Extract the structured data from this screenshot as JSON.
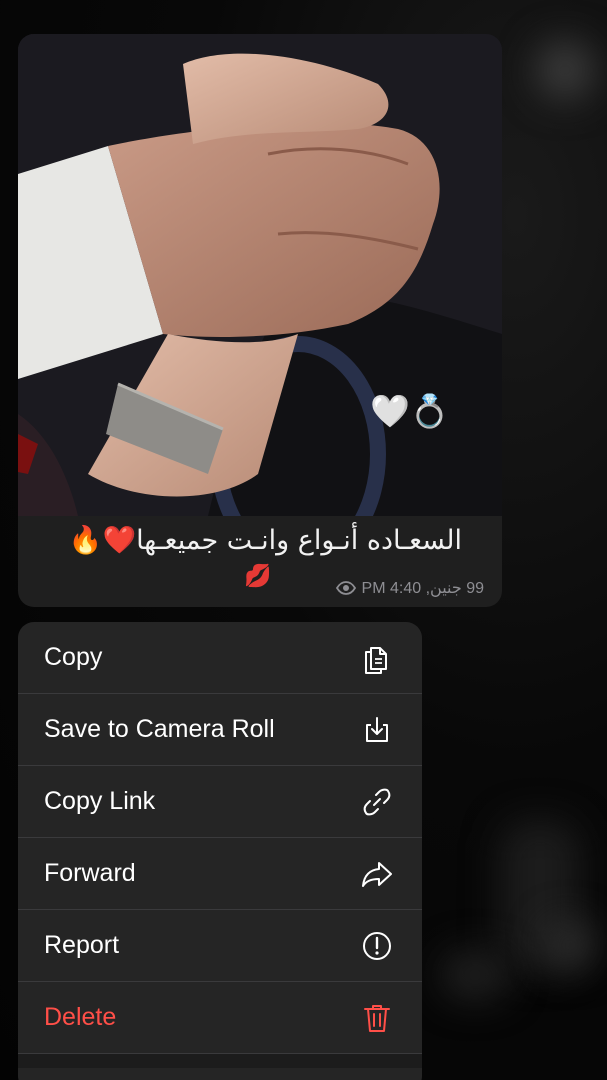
{
  "message": {
    "caption": "السعـاده أنـواع وانـت جميعـها❤️🔥",
    "caption_emoji": "💋",
    "photo_emoji": "🤍💍",
    "date_time": "99 جنين, PM 4:40",
    "views_icon": "eye-icon"
  },
  "menu": {
    "items": [
      {
        "label": "Copy",
        "icon": "copy-icon"
      },
      {
        "label": "Save to Camera Roll",
        "icon": "download-icon"
      },
      {
        "label": "Copy Link",
        "icon": "link-icon"
      },
      {
        "label": "Forward",
        "icon": "forward-icon"
      },
      {
        "label": "Report",
        "icon": "exclamation-icon"
      },
      {
        "label": "Delete",
        "icon": "trash-icon",
        "color": "#ff4f48"
      }
    ]
  },
  "colors": {
    "background": "#050505",
    "card": "#1f1f1f",
    "menu": "#252525",
    "danger": "#ff4f48",
    "meta_text": "#8e8e93"
  }
}
